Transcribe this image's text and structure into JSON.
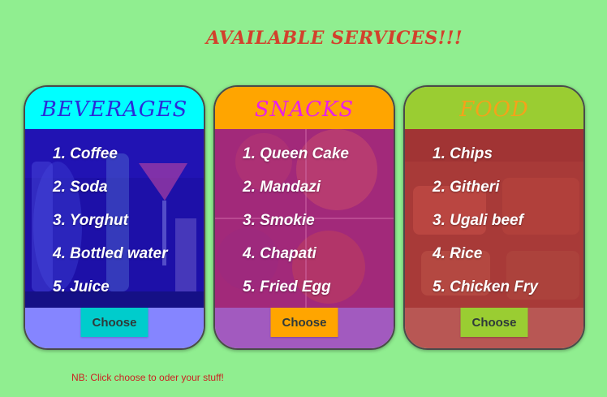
{
  "page": {
    "title": "AVAILABLE SERVICES!!!",
    "note": "NB: Click choose to oder your stuff!"
  },
  "cards": [
    {
      "heading": "BEVERAGES",
      "items": [
        "1. Coffee",
        "2. Soda",
        "3. Yorghut",
        "4. Bottled water",
        "5. Juice"
      ],
      "button": "Choose"
    },
    {
      "heading": "SNACKS",
      "items": [
        "1. Queen Cake",
        "2. Mandazi",
        "3. Smokie",
        "4. Chapati",
        "5. Fried Egg"
      ],
      "button": "Choose"
    },
    {
      "heading": "FOOD",
      "items": [
        "1. Chips",
        "2. Githeri",
        "3. Ugali beef",
        "4. Rice",
        "5. Chicken Fry"
      ],
      "button": "Choose"
    }
  ],
  "colors": {
    "background": "#90ee90",
    "title": "#d2412c",
    "beverages_header": "#00ffff",
    "snacks_header": "#ffa500",
    "food_header": "#9acd32"
  }
}
